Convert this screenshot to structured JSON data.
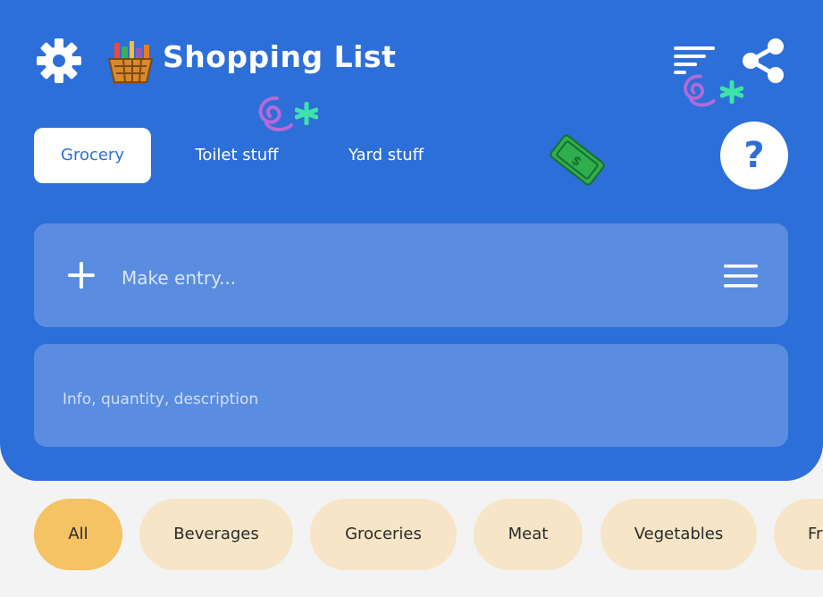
{
  "header": {
    "title": "Shopping List",
    "tabs": [
      {
        "label": "Grocery",
        "active": true
      },
      {
        "label": "Toilet stuff",
        "active": false
      },
      {
        "label": "Yard stuff",
        "active": false
      }
    ],
    "help_label": "?"
  },
  "entry": {
    "placeholder": "Make entry...",
    "info_placeholder": "Info, quantity, description"
  },
  "categories": [
    {
      "label": "All",
      "active": true
    },
    {
      "label": "Beverages",
      "active": false
    },
    {
      "label": "Groceries",
      "active": false
    },
    {
      "label": "Meat",
      "active": false
    },
    {
      "label": "Vegetables",
      "active": false
    },
    {
      "label": "Fr",
      "active": false
    }
  ],
  "colors": {
    "header_bg": "#2d6fd8",
    "input_bg": "#5a8ddf",
    "chip_bg": "#f6e5c6",
    "chip_active_bg": "#f5c264",
    "page_bg": "#f3f3f3"
  },
  "icons": [
    "gear-icon",
    "basket-icon",
    "sort-icon",
    "share-icon",
    "plus-icon",
    "hamburger-icon",
    "money-icon",
    "swirl-icon",
    "sparkle-icon"
  ]
}
